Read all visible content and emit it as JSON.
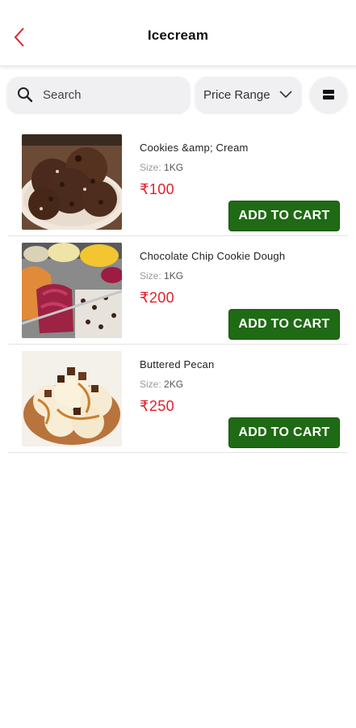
{
  "header": {
    "title": "Icecream",
    "back_icon": "chevron-left-icon",
    "accent_color": "#e3202a"
  },
  "filters": {
    "search_placeholder": "Search",
    "search_icon": "search-icon",
    "price_range_label": "Price Range",
    "dropdown_icon": "chevron-down-icon",
    "view_toggle_icon": "list-view-icon"
  },
  "products": [
    {
      "name": "Cookies &amp; Cream",
      "size_label": "Size: ",
      "size_value": "1KG",
      "price": "₹100",
      "cart_label": "ADD TO CART"
    },
    {
      "name": "Chocolate Chip Cookie Dough",
      "size_label": "Size: ",
      "size_value": "1KG",
      "price": "₹200",
      "cart_label": "ADD TO CART"
    },
    {
      "name": "Buttered Pecan",
      "size_label": "Size: ",
      "size_value": "2KG",
      "price": "₹250",
      "cart_label": "ADD TO CART"
    }
  ],
  "colors": {
    "price": "#e3202a",
    "button": "#1f6a14",
    "button_text": "#ffffff"
  }
}
